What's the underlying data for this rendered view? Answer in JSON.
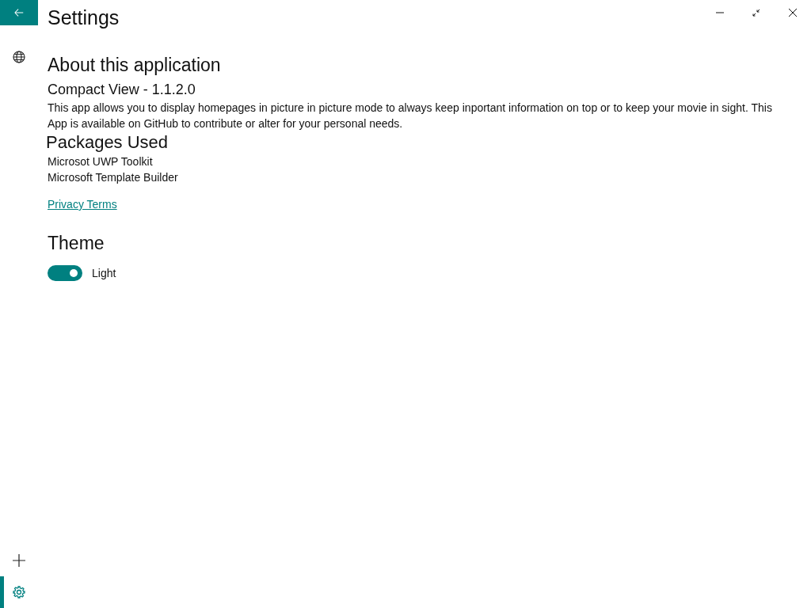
{
  "window": {
    "title": "Settings",
    "controls": [
      {
        "kind": "minimize"
      },
      {
        "kind": "restore"
      },
      {
        "kind": "close"
      }
    ]
  },
  "back_button": {
    "kind": "back"
  },
  "sidebar": {
    "top_items": [
      {
        "kind": "globe",
        "selected": false
      }
    ],
    "bottom_items": [
      {
        "kind": "add",
        "selected": false
      },
      {
        "kind": "settings",
        "selected": true
      }
    ]
  },
  "about": {
    "heading": "About this application",
    "app_name": "Compact View - 1.1.2.0",
    "description": "This app allows you to display homepages in picture in picture mode to always keep inportant information on top or to keep your movie in sight. This App is available on GitHub to contribute or alter for your personal needs.",
    "packages_heading": "Packages Used",
    "packages": [
      "Microsot UWP Toolkit",
      "Microsoft Template Builder"
    ],
    "link": "Privacy Terms"
  },
  "theme": {
    "heading": "Theme",
    "toggle": {
      "label": "Light",
      "on": true
    }
  }
}
